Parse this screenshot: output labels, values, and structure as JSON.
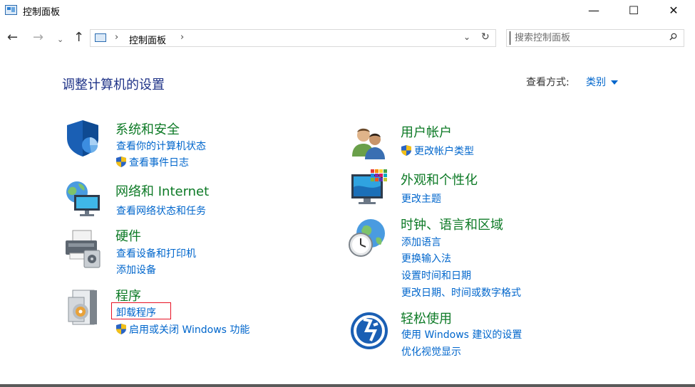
{
  "window": {
    "title": "控制面板",
    "minimize": "—",
    "maximize": "☐",
    "close": "✕"
  },
  "address": {
    "back": "←",
    "forward": "→",
    "recent": "⌄",
    "up": "↑",
    "path_separator": "›",
    "path": "控制面板",
    "dropdown": "⌄",
    "refresh": "↻"
  },
  "search": {
    "placeholder": "搜索控制面板",
    "value": ""
  },
  "main": {
    "title": "调整计算机的设置",
    "view_label": "查看方式:",
    "view_value": "类别"
  },
  "categories": [
    {
      "title": "系统和安全",
      "icon": "shield-icon",
      "links": [
        "查看你的计算机状态",
        "查看事件日志"
      ]
    },
    {
      "title": "网络和 Internet",
      "icon": "network-globe-icon",
      "links": [
        "查看网络状态和任务"
      ]
    },
    {
      "title": "硬件",
      "icon": "printer-icon",
      "links": [
        "查看设备和打印机",
        "添加设备"
      ]
    },
    {
      "title": "程序",
      "icon": "programs-disc-icon",
      "links": [
        "卸载程序",
        "启用或关闭 Windows 功能"
      ]
    },
    {
      "title": "用户帐户",
      "icon": "users-icon",
      "links": [
        "更改帐户类型"
      ]
    },
    {
      "title": "外观和个性化",
      "icon": "monitor-palette-icon",
      "links": [
        "更改主题"
      ]
    },
    {
      "title": "时钟、语言和区域",
      "icon": "clock-globe-icon",
      "links": [
        "添加语言",
        "更换输入法",
        "设置时间和日期",
        "更改日期、时间或数字格式"
      ]
    },
    {
      "title": "轻松使用",
      "icon": "ease-of-access-icon",
      "links": [
        "使用 Windows 建议的设置",
        "优化视觉显示"
      ]
    }
  ],
  "colors": {
    "category_title": "#0d7a26",
    "link": "#0066cc",
    "page_title": "#1e3287",
    "highlight": "#e81123"
  }
}
